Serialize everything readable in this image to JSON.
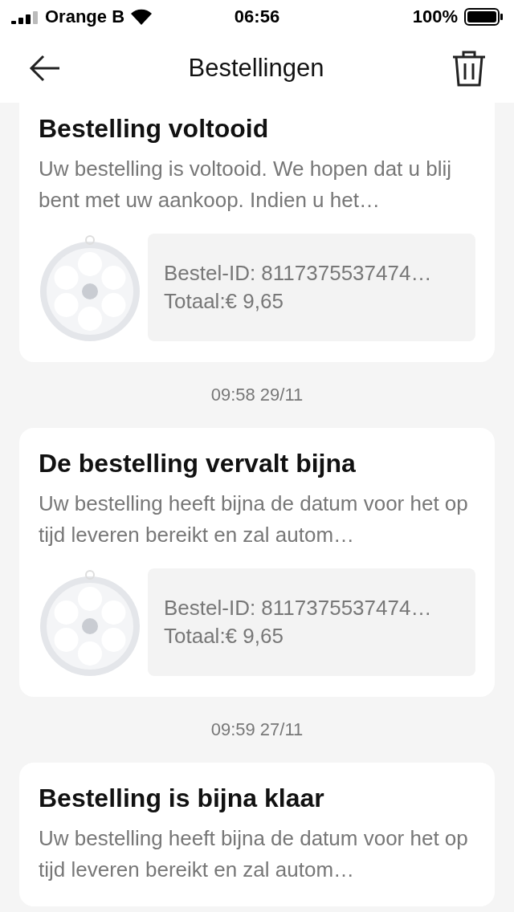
{
  "status_bar": {
    "carrier": "Orange B",
    "time": "06:56",
    "battery": "100%"
  },
  "header": {
    "title": "Bestellingen"
  },
  "feed": [
    {
      "kind": "message",
      "title": "Bestelling voltooid",
      "body": "Uw bestelling is voltooid. We hopen dat u blij bent met uw aankoop. Indien u het…",
      "product": {
        "order_id": "Bestel-ID: 8117375537474…",
        "total": "Totaal:€ 9,65"
      }
    },
    {
      "kind": "time",
      "text": "09:58 29/11"
    },
    {
      "kind": "message",
      "title": "De bestelling vervalt bijna",
      "body": "Uw bestelling heeft bijna de datum voor het op tijd leveren bereikt en zal autom…",
      "product": {
        "order_id": "Bestel-ID: 8117375537474…",
        "total": "Totaal:€ 9,65"
      }
    },
    {
      "kind": "time",
      "text": "09:59 27/11"
    },
    {
      "kind": "message",
      "title": "Bestelling is bijna klaar",
      "body": "Uw bestelling heeft bijna de datum voor het op tijd leveren bereikt en zal autom…"
    }
  ]
}
